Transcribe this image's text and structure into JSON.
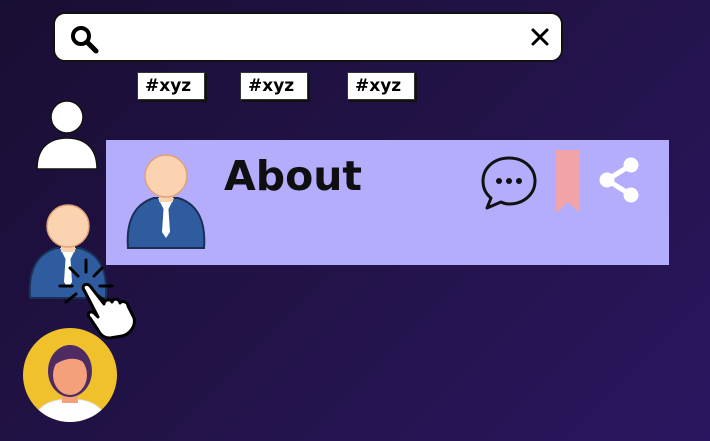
{
  "search": {
    "value": "",
    "placeholder": "",
    "search_icon": "search-icon",
    "close_icon": "close-icon"
  },
  "tags": [
    "#xyz",
    "#xyz",
    "#xyz"
  ],
  "sidebar": {
    "items": [
      {
        "icon": "user-silhouette-icon"
      },
      {
        "icon": "male-businessman-avatar"
      },
      {
        "icon": "female-avatar"
      }
    ]
  },
  "card": {
    "title": "About",
    "avatar": "male-businessman-avatar",
    "actions": [
      "comment-icon",
      "bookmark-icon",
      "share-icon"
    ]
  },
  "colors": {
    "background": "#1e1040",
    "card": "#b4adfc",
    "bookmark": "#f2a3a7",
    "female_avatar_bg": "#f0c12b",
    "suit": "#2e5c9e",
    "skin": "#fbd3b0"
  },
  "cursor": {
    "icon": "pointer-hand-click-icon"
  }
}
